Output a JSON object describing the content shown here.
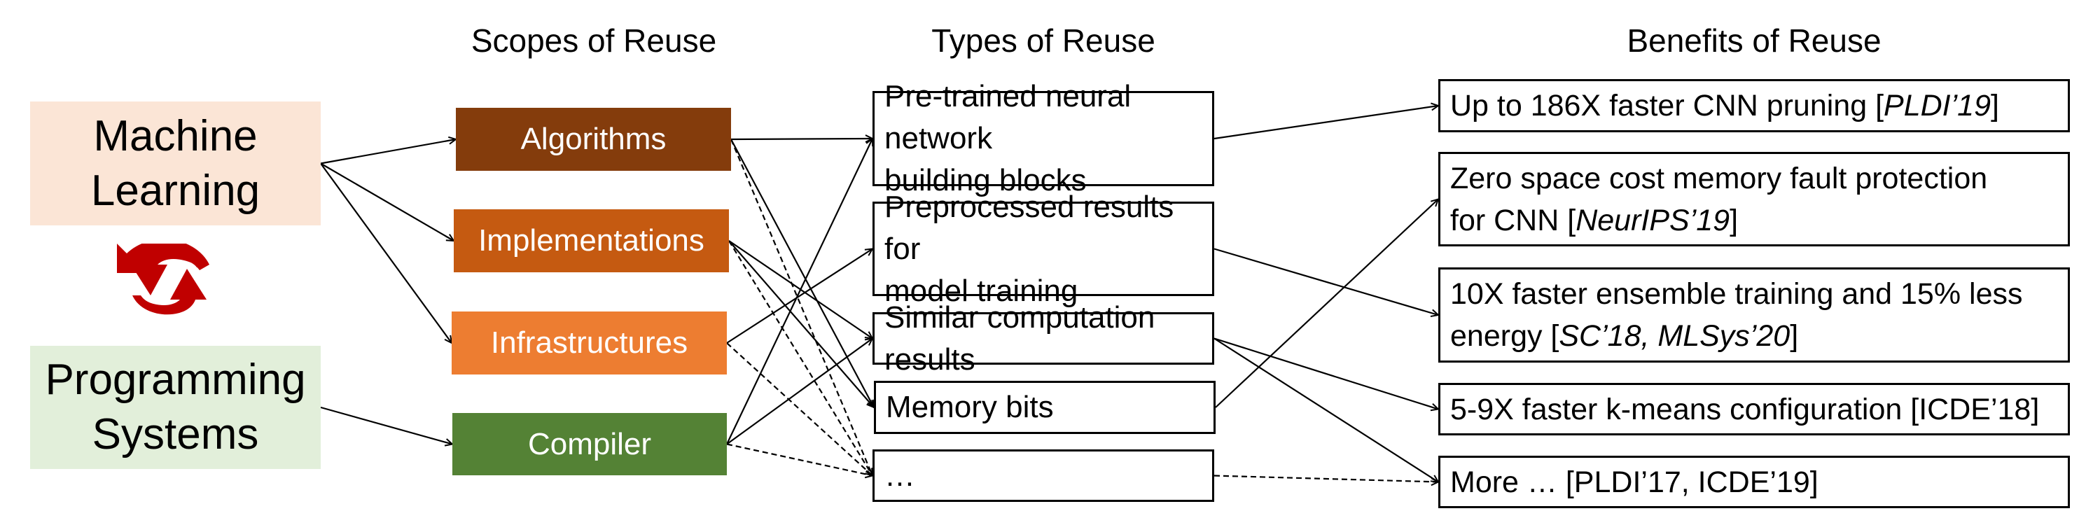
{
  "headers": {
    "scopes": "Scopes of Reuse",
    "types": "Types of Reuse",
    "benefits": "Benefits of Reuse"
  },
  "domains": [
    {
      "id": "ml",
      "label_line1": "Machine",
      "label_line2": "Learning",
      "color": "#FBE5D6"
    },
    {
      "id": "ps",
      "label_line1": "Programming",
      "label_line2": "Systems",
      "color": "#E2EFDA"
    }
  ],
  "cycle_icon": {
    "name": "cycle-icon",
    "color": "#C00000"
  },
  "scopes": [
    {
      "id": "algorithms",
      "label": "Algorithms",
      "color": "#843C0C"
    },
    {
      "id": "implementations",
      "label": "Implementations",
      "color": "#C55A11"
    },
    {
      "id": "infrastructures",
      "label": "Infrastructures",
      "color": "#ED7D31"
    },
    {
      "id": "compiler",
      "label": "Compiler",
      "color": "#548235"
    }
  ],
  "types": [
    {
      "id": "pretrained",
      "line1": "Pre-trained neural network",
      "line2": "building blocks"
    },
    {
      "id": "preprocessed",
      "line1": "Preprocessed results for",
      "line2": "model training"
    },
    {
      "id": "similar",
      "line1": "Similar computation results",
      "line2": ""
    },
    {
      "id": "memory",
      "line1": "Memory bits",
      "line2": ""
    },
    {
      "id": "more",
      "line1": "…",
      "line2": ""
    }
  ],
  "benefits": [
    {
      "id": "b1",
      "line1_text": "Up to 186X faster CNN pruning [",
      "line1_italic": "PLDI’19",
      "line1_end": "]",
      "line2_text": "",
      "line2_italic": "",
      "line2_end": ""
    },
    {
      "id": "b2",
      "line1_text": "Zero space cost memory fault protection",
      "line1_italic": "",
      "line1_end": "",
      "line2_text": "for CNN [",
      "line2_italic": "NeurIPS’19",
      "line2_end": "]"
    },
    {
      "id": "b3",
      "line1_text": "10X faster ensemble training and 15% less",
      "line1_italic": "",
      "line1_end": "",
      "line2_text": "energy [",
      "line2_italic": "SC’18, MLSys’20",
      "line2_end": "]"
    },
    {
      "id": "b4",
      "line1_text": "5-9X faster k-means configuration [ICDE’18]",
      "line1_italic": "",
      "line1_end": "",
      "line2_text": "",
      "line2_italic": "",
      "line2_end": ""
    },
    {
      "id": "b5",
      "line1_text": "More … [PLDI’17, ICDE’19]",
      "line1_italic": "",
      "line1_end": "",
      "line2_text": "",
      "line2_italic": "",
      "line2_end": ""
    }
  ],
  "edges": [
    {
      "from": "ml",
      "to": "algorithms",
      "style": "solid"
    },
    {
      "from": "ml",
      "to": "implementations",
      "style": "solid"
    },
    {
      "from": "ml",
      "to": "infrastructures",
      "style": "solid"
    },
    {
      "from": "ps",
      "to": "compiler",
      "style": "solid"
    },
    {
      "from": "algorithms",
      "to": "pretrained",
      "style": "solid"
    },
    {
      "from": "algorithms",
      "to": "memory",
      "style": "solid"
    },
    {
      "from": "algorithms",
      "to": "more",
      "style": "dashed"
    },
    {
      "from": "implementations",
      "to": "similar",
      "style": "solid"
    },
    {
      "from": "implementations",
      "to": "memory",
      "style": "solid"
    },
    {
      "from": "implementations",
      "to": "more",
      "style": "dashed"
    },
    {
      "from": "infrastructures",
      "to": "preprocessed",
      "style": "solid"
    },
    {
      "from": "infrastructures",
      "to": "more",
      "style": "dashed"
    },
    {
      "from": "compiler",
      "to": "pretrained",
      "style": "solid"
    },
    {
      "from": "compiler",
      "to": "similar",
      "style": "solid"
    },
    {
      "from": "compiler",
      "to": "more",
      "style": "dashed"
    },
    {
      "from": "pretrained",
      "to": "b1",
      "style": "solid"
    },
    {
      "from": "preprocessed",
      "to": "b3",
      "style": "solid"
    },
    {
      "from": "similar",
      "to": "b4",
      "style": "solid"
    },
    {
      "from": "similar",
      "to": "b5",
      "style": "solid"
    },
    {
      "from": "memory",
      "to": "b2",
      "style": "solid"
    },
    {
      "from": "more",
      "to": "b5",
      "style": "dashed"
    }
  ]
}
